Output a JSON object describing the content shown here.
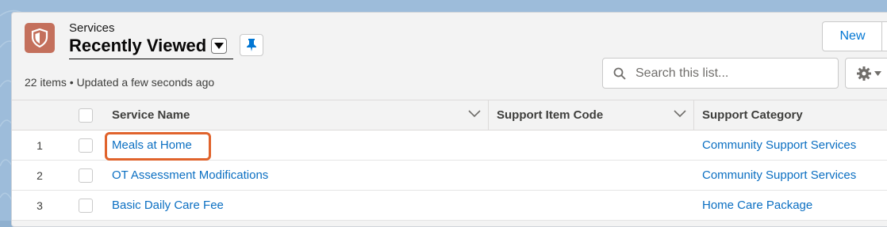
{
  "header": {
    "object_label": "Services",
    "list_title": "Recently Viewed",
    "status": "22 items • Updated a few seconds ago",
    "new_button": "New"
  },
  "icons": {
    "object": "shield-icon",
    "list_dropdown": "caret-down-icon",
    "pin": "pin-icon",
    "search": "search-icon",
    "settings": "gear-icon",
    "settings_dropdown": "caret-down-icon"
  },
  "search": {
    "placeholder": "Search this list..."
  },
  "table": {
    "columns": [
      "Service Name",
      "Support Item Code",
      "Support Category"
    ],
    "rows": [
      {
        "num": "1",
        "name": "Meals at Home",
        "code": "",
        "category": "Community Support Services"
      },
      {
        "num": "2",
        "name": "OT Assessment Modifications",
        "code": "",
        "category": "Community Support Services"
      },
      {
        "num": "3",
        "name": "Basic Daily Care Fee",
        "code": "",
        "category": "Home Care Package"
      }
    ]
  },
  "colors": {
    "accent": "#0176d3",
    "object_icon": "#c4705c",
    "highlight": "#e0632c",
    "link": "#0b6fc2"
  }
}
